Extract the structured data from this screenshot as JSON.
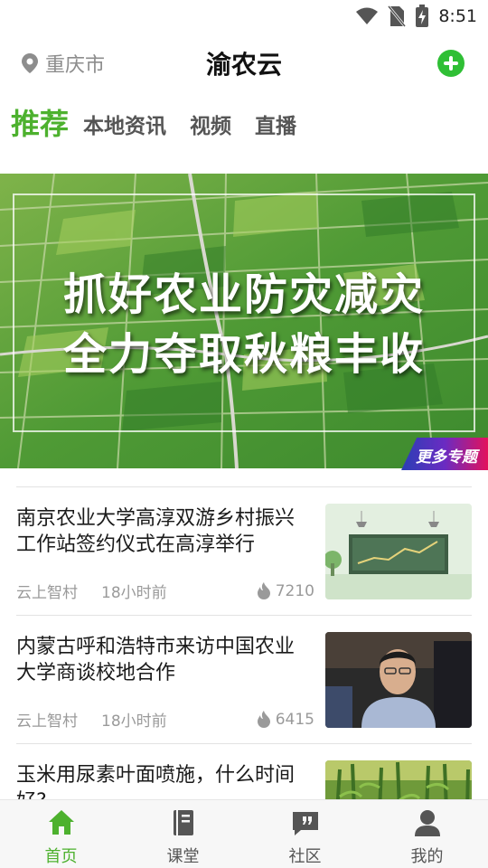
{
  "status_bar": {
    "time": "8:51"
  },
  "header": {
    "location": "重庆市",
    "title": "渝农云"
  },
  "tabs": [
    {
      "label": "推荐",
      "active": true
    },
    {
      "label": "本地资讯",
      "active": false
    },
    {
      "label": "视频",
      "active": false
    },
    {
      "label": "直播",
      "active": false
    }
  ],
  "banner": {
    "line1": "抓好农业防灾减灾",
    "line2": "全力夺取秋粮丰收",
    "special_label": "更多专题"
  },
  "news": [
    {
      "title": "南京农业大学高淳双游乡村振兴工作站签约仪式在高淳举行",
      "source": "云上智村",
      "time": "18小时前",
      "views": "7210"
    },
    {
      "title": "内蒙古呼和浩特市来访中国农业大学商谈校地合作",
      "source": "云上智村",
      "time": "18小时前",
      "views": "6415"
    },
    {
      "title": "玉米用尿素叶面喷施，什么时间好?",
      "source": "",
      "time": "",
      "views": ""
    }
  ],
  "bottom_nav": [
    {
      "label": "首页",
      "icon": "home-icon",
      "active": true
    },
    {
      "label": "课堂",
      "icon": "book-icon",
      "active": false
    },
    {
      "label": "社区",
      "icon": "chat-quote-icon",
      "active": false
    },
    {
      "label": "我的",
      "icon": "user-icon",
      "active": false
    }
  ],
  "colors": {
    "accent": "#4db12e",
    "add_button": "#2fbf35"
  }
}
